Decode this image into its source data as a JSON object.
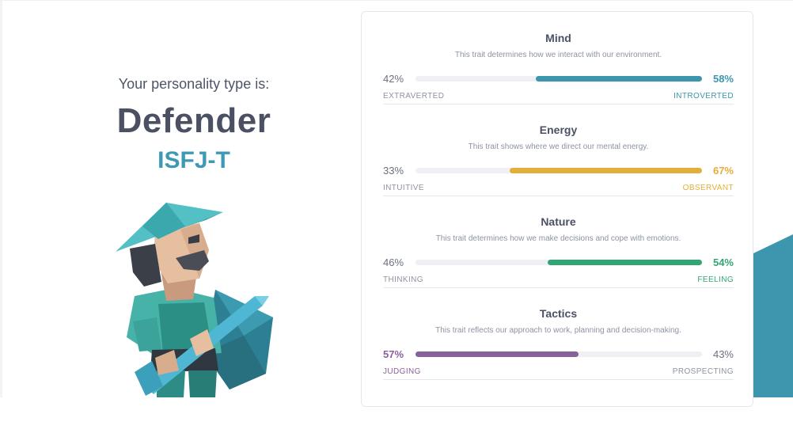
{
  "intro": {
    "label": "Your personality type is:",
    "type_name": "Defender",
    "type_code": "ISFJ-T"
  },
  "traits": [
    {
      "title": "Mind",
      "description": "This trait determines how we interact with our environment.",
      "left_pct": "42%",
      "right_pct": "58%",
      "left_label": "EXTRAVERTED",
      "right_label": "INTROVERTED",
      "dominant": "right",
      "dominant_fraction": 0.58,
      "color": "#3d96ae"
    },
    {
      "title": "Energy",
      "description": "This trait shows where we direct our mental energy.",
      "left_pct": "33%",
      "right_pct": "67%",
      "left_label": "INTUITIVE",
      "right_label": "OBSERVANT",
      "dominant": "right",
      "dominant_fraction": 0.67,
      "color": "#e4ae3a"
    },
    {
      "title": "Nature",
      "description": "This trait determines how we make decisions and cope with emotions.",
      "left_pct": "46%",
      "right_pct": "54%",
      "left_label": "THINKING",
      "right_label": "FEELING",
      "dominant": "right",
      "dominant_fraction": 0.54,
      "color": "#33a474"
    },
    {
      "title": "Tactics",
      "description": "This trait reflects our approach to work, planning and decision-making.",
      "left_pct": "57%",
      "right_pct": "43%",
      "left_label": "JUDGING",
      "right_label": "PROSPECTING",
      "dominant": "left",
      "dominant_fraction": 0.57,
      "color": "#88619a"
    }
  ],
  "colors": {
    "text_dark": "#4b5163",
    "text_muted": "#8d93a2",
    "type_code": "#3d99b4",
    "accent_blue": "#3d96ae"
  },
  "icons": {
    "illustration": "defender-character-illustration"
  }
}
